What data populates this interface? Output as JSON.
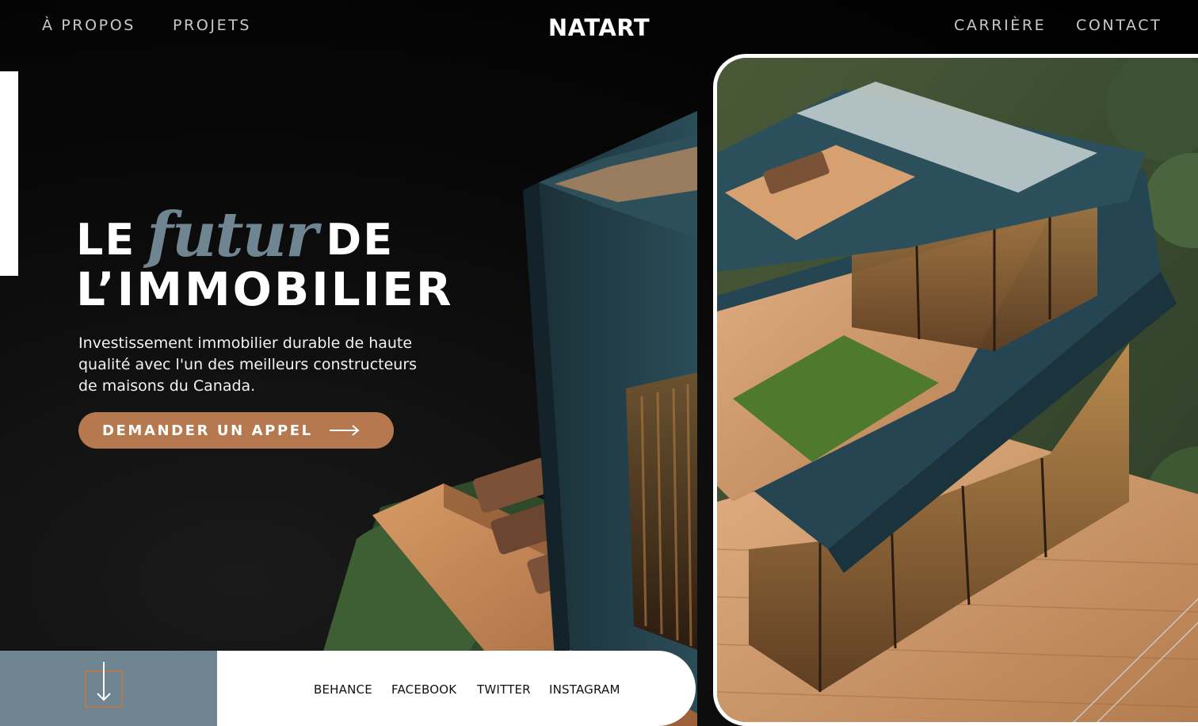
{
  "nav": {
    "about": "À PROPOS",
    "projects": "PROJETS",
    "brand": "NATART",
    "careers": "CARRIÈRE",
    "contact": "CONTACT"
  },
  "hero": {
    "word_le": "LE",
    "word_futur": "futur",
    "word_de": "DE",
    "word_immobilier": "L’IMMOBILIER",
    "lead": "Investissement immobilier durable de haute qualité avec l'un des meilleurs constructeurs de maisons du Canada.",
    "cta_label": "DEMANDER UN APPEL"
  },
  "social": {
    "behance": "BEHANCE",
    "facebook": "FACEBOOK",
    "twitter": "TWITTER",
    "instagram": "INSTAGRAM"
  },
  "colors": {
    "accent_copper": "#b6784e",
    "accent_slate": "#6f8591",
    "background": "#000000",
    "house_teal": "#1f3b44",
    "wood": "#c4885a"
  },
  "icons": {
    "cta": "arrow-right-icon",
    "scroll": "arrow-down-icon"
  }
}
